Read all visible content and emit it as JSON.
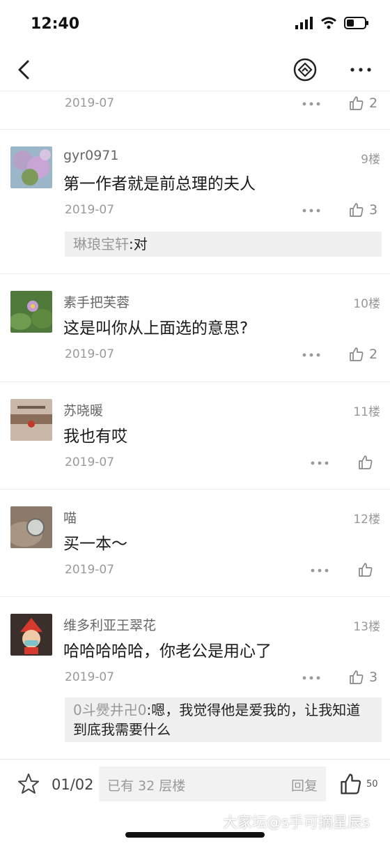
{
  "status": {
    "time": "12:40"
  },
  "colors": {
    "accent": "#222222",
    "muted": "#999999",
    "reply_bg": "#f0f0f0"
  },
  "nav": {
    "icons": [
      "back-icon",
      "share-icon",
      "more-icon"
    ]
  },
  "top_partial": {
    "date": "2019-07",
    "likes": "2"
  },
  "posts": [
    {
      "user": "gyr0971",
      "floor": "9楼",
      "content": "第一作者就是前总理的夫人",
      "date": "2019-07",
      "likes": "3",
      "reply": {
        "name": "琳琅宝轩",
        "text": ":对"
      }
    },
    {
      "user": "素手把芙蓉",
      "floor": "10楼",
      "content": "这是叫你从上面选的意思?",
      "date": "2019-07",
      "likes": "2"
    },
    {
      "user": "苏晓暖",
      "floor": "11楼",
      "content": "我也有哎",
      "date": "2019-07",
      "likes": ""
    },
    {
      "user": "喵",
      "floor": "12楼",
      "content": "买一本～",
      "date": "2019-07",
      "likes": ""
    },
    {
      "user": "维多利亚王翠花",
      "floor": "13楼",
      "content": "哈哈哈哈哈，你老公是用心了",
      "date": "2019-07",
      "likes": "3",
      "reply": {
        "name": "0斗㸑井卍0",
        "text": ":嗯，我觉得他是爱我的，让我知道到底我需要什么"
      }
    }
  ],
  "bottom": {
    "pager": "01/02",
    "input_placeholder": "已有 32 层楼",
    "reply_label": "回复",
    "like_count": "50",
    "watermark": "大家坛@s手可摘星辰s"
  }
}
